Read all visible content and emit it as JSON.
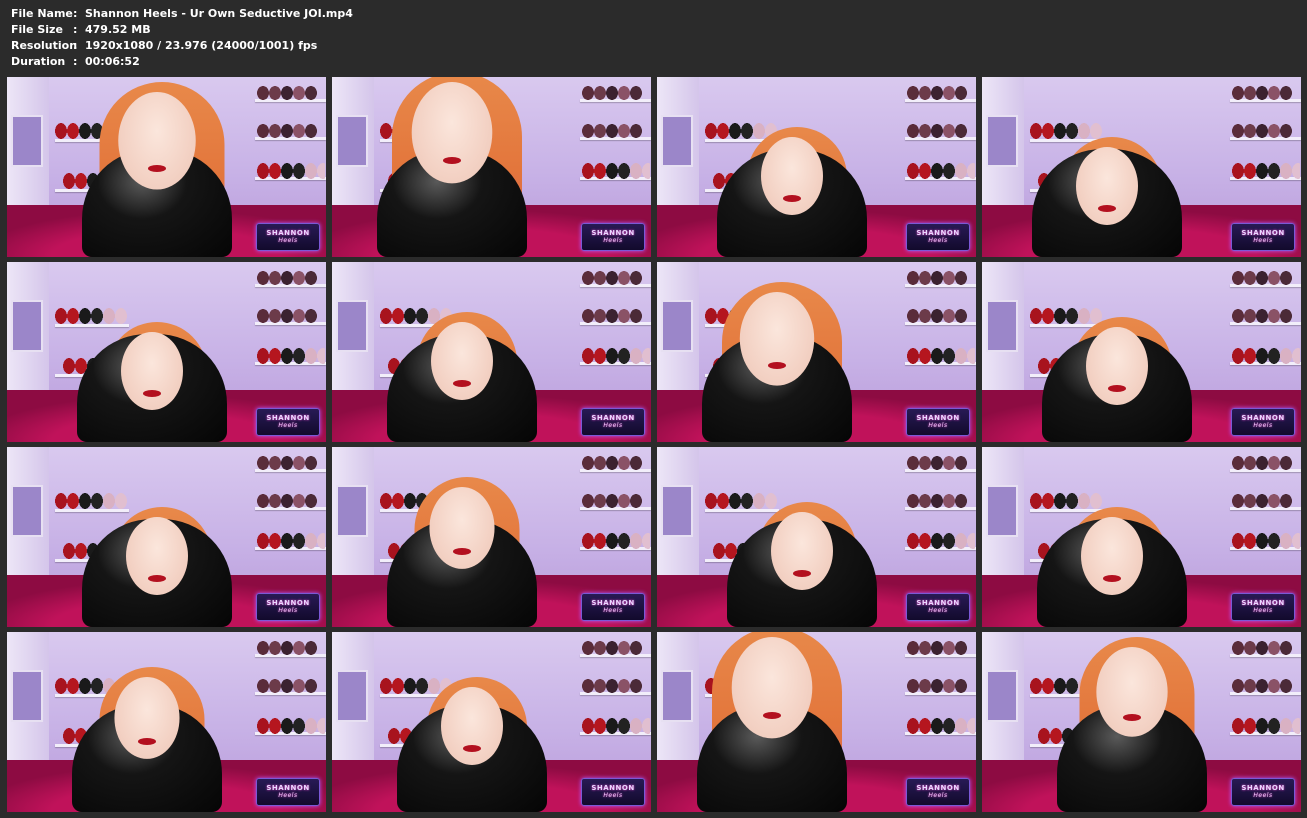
{
  "info": {
    "file_name_label": "File Name",
    "file_name": "Shannon Heels - Ur Own Seductive JOI.mp4",
    "file_size_label": "File Size",
    "file_size": "479.52 MB",
    "resolution_label": "Resolution",
    "resolution": "1920x1080 / 23.976 (24000/1001) fps",
    "duration_label": "Duration",
    "duration": "00:06:52",
    "separator": ":"
  },
  "thumbnails": {
    "count": 16,
    "columns": 4,
    "rows": 4,
    "watermark_line1": "SHANNON",
    "watermark_line2": "Heels"
  },
  "colors": {
    "background": "#2b2b2b",
    "text": "#ffffff",
    "wall": "#c7b1e6",
    "chair": "#c0125a",
    "hair": "#e3763c",
    "latex": "#0a0a0a"
  }
}
